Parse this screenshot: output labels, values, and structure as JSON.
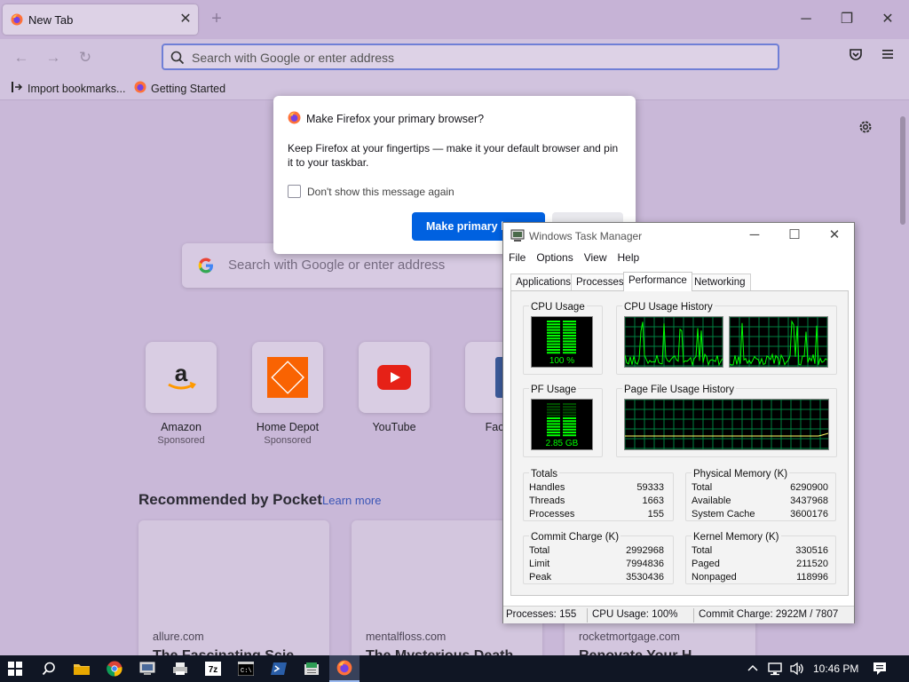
{
  "browser": {
    "tab_title": "New Tab",
    "address_placeholder": "Search with Google or enter address",
    "bookmarks": [
      "Import bookmarks...",
      "Getting Started"
    ]
  },
  "newtab": {
    "search_placeholder": "Search with Google or enter address",
    "top_sites": [
      {
        "name": "Amazon",
        "sponsored": "Sponsored"
      },
      {
        "name": "Home Depot",
        "sponsored": "Sponsored"
      },
      {
        "name": "YouTube",
        "sponsored": ""
      },
      {
        "name": "Faceb",
        "sponsored": ""
      }
    ],
    "pocket_heading": "Recommended by Pocket",
    "pocket_link": "Learn more",
    "cards": [
      {
        "source": "allure.com",
        "title": "The Fascinating Scie"
      },
      {
        "source": "mentalfloss.com",
        "title": "The Mysterious Death"
      },
      {
        "source": "rocketmortgage.com",
        "title": "Renovate Your H"
      }
    ]
  },
  "dialog": {
    "title": "Make Firefox your primary browser?",
    "body": "Keep Firefox at your fingertips — make it your default browser and pin it to your taskbar.",
    "checkbox_label": "Don't show this message again",
    "primary_button": "Make primary browser"
  },
  "taskmanager": {
    "title": "Windows Task Manager",
    "menu": [
      "File",
      "Options",
      "View",
      "Help"
    ],
    "tabs": [
      "Applications",
      "Processes",
      "Performance",
      "Networking"
    ],
    "selected_tab": "Performance",
    "cpu_usage_label": "CPU Usage",
    "cpu_usage_value": "100 %",
    "cpu_history_label": "CPU Usage History",
    "pf_usage_label": "PF Usage",
    "pf_usage_value": "2.85 GB",
    "pf_history_label": "Page File Usage History",
    "totals": {
      "label": "Totals",
      "rows": [
        [
          "Handles",
          "59333"
        ],
        [
          "Threads",
          "1663"
        ],
        [
          "Processes",
          "155"
        ]
      ]
    },
    "physical": {
      "label": "Physical Memory (K)",
      "rows": [
        [
          "Total",
          "6290900"
        ],
        [
          "Available",
          "3437968"
        ],
        [
          "System Cache",
          "3600176"
        ]
      ]
    },
    "commit": {
      "label": "Commit Charge (K)",
      "rows": [
        [
          "Total",
          "2992968"
        ],
        [
          "Limit",
          "7994836"
        ],
        [
          "Peak",
          "3530436"
        ]
      ]
    },
    "kernel": {
      "label": "Kernel Memory (K)",
      "rows": [
        [
          "Total",
          "330516"
        ],
        [
          "Paged",
          "211520"
        ],
        [
          "Nonpaged",
          "118996"
        ]
      ]
    },
    "status": {
      "processes": "Processes: 155",
      "cpu": "CPU Usage: 100%",
      "commit": "Commit Charge: 2922M / 7807"
    }
  },
  "taskbar": {
    "clock": "10:46 PM"
  },
  "colors": {
    "firefox_tint": "#c9b8d8",
    "primary_button": "#0061e0",
    "graph_green": "#00ff00",
    "graph_grid": "#008040",
    "taskbar": "#101624"
  }
}
